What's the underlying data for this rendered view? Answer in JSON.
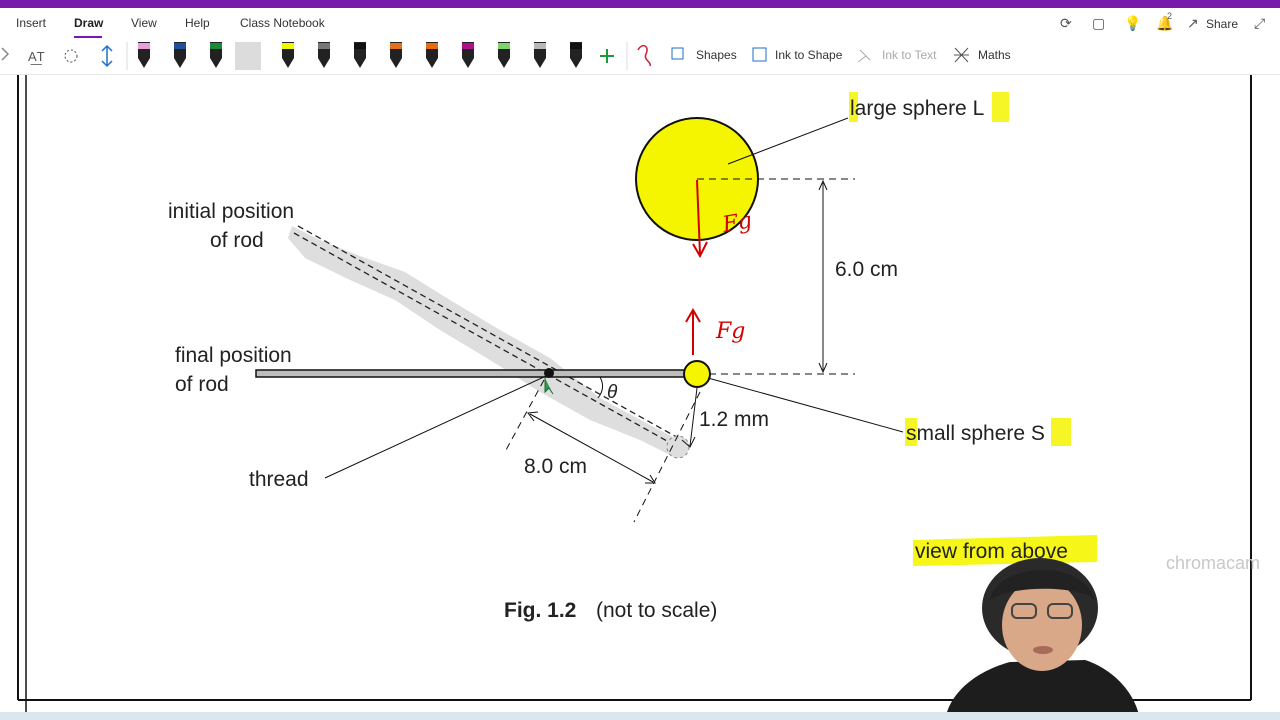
{
  "ribbon": {
    "tabs": [
      "Insert",
      "Draw",
      "View",
      "Help",
      "Class Notebook"
    ],
    "active_tab": "Draw",
    "share_label": "Share",
    "notification_count": "2"
  },
  "draw_toolbar": {
    "shapes_label": "Shapes",
    "ink_to_shape_label": "Ink to Shape",
    "ink_to_text_label": "Ink to Text",
    "maths_label": "Maths",
    "pens": [
      {
        "name": "pen-pink-marker",
        "color": "#e8a0d8"
      },
      {
        "name": "pen-blue",
        "color": "#1e4f9c"
      },
      {
        "name": "pen-green",
        "color": "#1a8a3a"
      },
      {
        "name": "pen-red",
        "color": "#d40000"
      },
      {
        "name": "highlighter-yellow",
        "color": "#f5f500"
      },
      {
        "name": "pen-gray",
        "color": "#777777"
      },
      {
        "name": "pen-black",
        "color": "#111111"
      },
      {
        "name": "pen-multicolor",
        "color": "#e07020"
      },
      {
        "name": "pen-orange",
        "color": "#e86a10"
      },
      {
        "name": "pen-purple",
        "color": "#b0108a"
      },
      {
        "name": "highlighter-green",
        "color": "#7ed36a"
      },
      {
        "name": "pen-silver",
        "color": "#b8b8b8"
      },
      {
        "name": "pen-black-2",
        "color": "#111111"
      }
    ]
  },
  "figure": {
    "label_large_sphere": "large sphere L",
    "label_initial_pos_1": "initial position",
    "label_initial_pos_2": "of rod",
    "label_final_pos_1": "final position",
    "label_final_pos_2": "of rod",
    "label_distance": "6.0 cm",
    "label_thread": "thread",
    "label_length": "8.0 cm",
    "label_mm": "1.2 mm",
    "label_small_sphere": "small sphere S",
    "label_theta": "θ",
    "label_view": "view from above",
    "caption_bold": "Fig. 1.2",
    "caption_rest": "(not to scale)",
    "ink_fg_top": "Fg",
    "ink_fg_bottom": "Fg"
  },
  "overlay": {
    "watermark": "chromacam"
  },
  "colors": {
    "accent": "#7719aa",
    "sphere_yellow": "#f5f500",
    "ink_red": "#d40000",
    "highlight": "#f5f500"
  }
}
